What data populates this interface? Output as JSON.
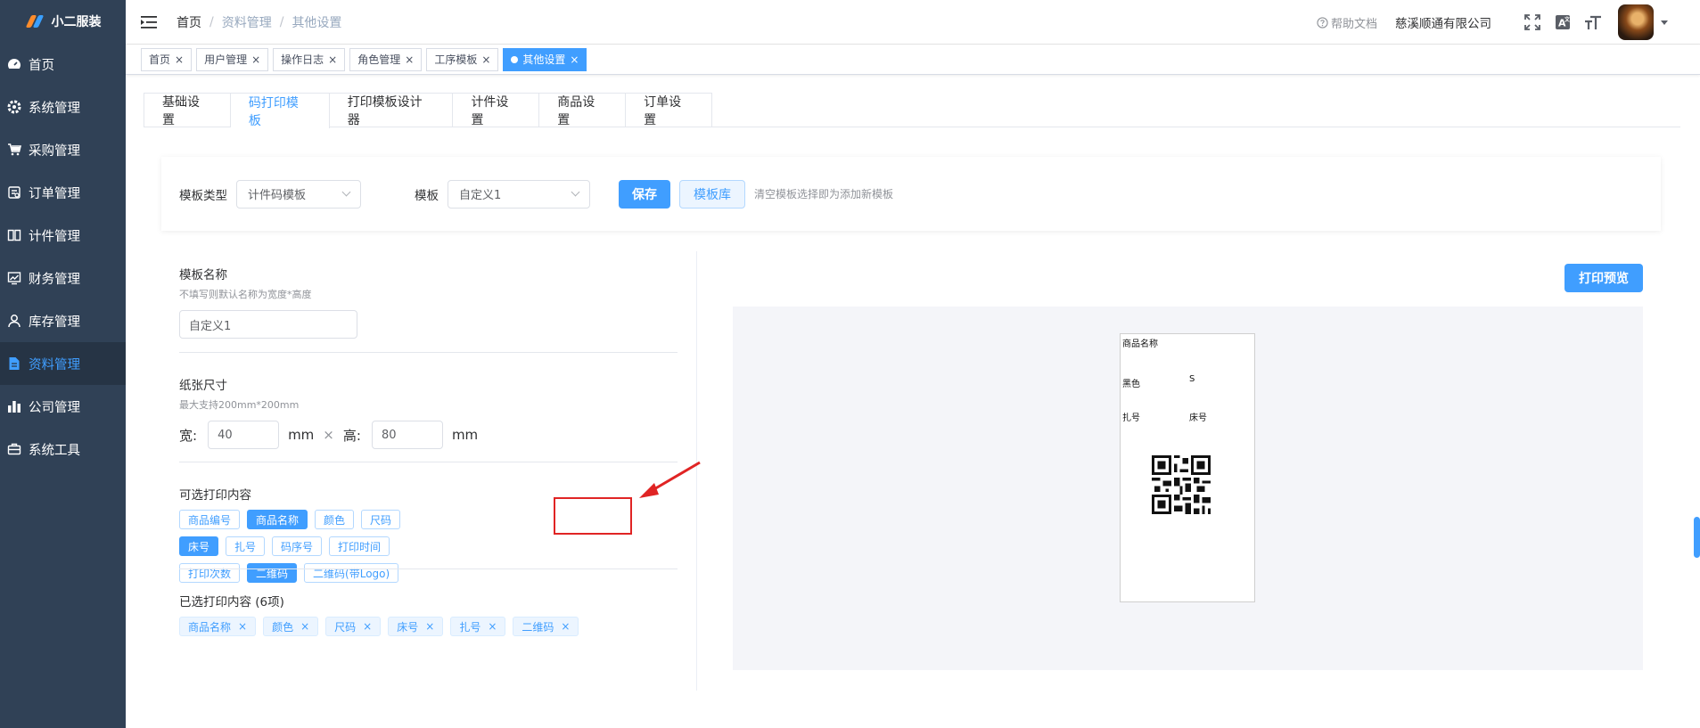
{
  "app": {
    "logo_text": "小二服装"
  },
  "sidebar": {
    "items": [
      {
        "label": "首页",
        "icon": "dashboard-icon",
        "active": false
      },
      {
        "label": "系统管理",
        "icon": "gear-icon",
        "active": false
      },
      {
        "label": "采购管理",
        "icon": "cart-icon",
        "active": false
      },
      {
        "label": "订单管理",
        "icon": "order-icon",
        "active": false
      },
      {
        "label": "计件管理",
        "icon": "book-icon",
        "active": false
      },
      {
        "label": "财务管理",
        "icon": "chart-icon",
        "active": false
      },
      {
        "label": "库存管理",
        "icon": "user-icon",
        "active": false
      },
      {
        "label": "资料管理",
        "icon": "document-icon",
        "active": true
      },
      {
        "label": "公司管理",
        "icon": "bar-chart-icon",
        "active": false
      },
      {
        "label": "系统工具",
        "icon": "toolbox-icon",
        "active": false
      }
    ]
  },
  "header": {
    "breadcrumb": [
      "首页",
      "资料管理",
      "其他设置"
    ],
    "help_label": "帮助文档",
    "company": "慈溪顺通有限公司"
  },
  "tags": [
    {
      "label": "首页",
      "active": false
    },
    {
      "label": "用户管理",
      "active": false
    },
    {
      "label": "操作日志",
      "active": false
    },
    {
      "label": "角色管理",
      "active": false
    },
    {
      "label": "工序模板",
      "active": false
    },
    {
      "label": "其他设置",
      "active": true
    }
  ],
  "tabs": [
    {
      "label": "基础设置",
      "active": false
    },
    {
      "label": "码打印模板",
      "active": true
    },
    {
      "label": "打印模板设计器",
      "active": false
    },
    {
      "label": "计件设置",
      "active": false
    },
    {
      "label": "商品设置",
      "active": false
    },
    {
      "label": "订单设置",
      "active": false
    }
  ],
  "filter": {
    "template_type_label": "模板类型",
    "template_type_value": "计件码模板",
    "template_label": "模板",
    "template_value": "自定义1",
    "save_label": "保存",
    "library_label": "模板库",
    "hint": "清空模板选择即为添加新模板"
  },
  "form": {
    "name_title": "模板名称",
    "name_hint": "不填写则默认名称为宽度*高度",
    "name_value": "自定义1",
    "paper_title": "纸张尺寸",
    "paper_hint": "最大支持200mm*200mm",
    "width_label": "宽:",
    "width_value": "40",
    "unit": "mm",
    "times": "×",
    "height_label": "高:",
    "height_value": "80",
    "optional_title": "可选打印内容",
    "optional_items": [
      {
        "label": "商品编号",
        "on": false
      },
      {
        "label": "商品名称",
        "on": true
      },
      {
        "label": "颜色",
        "on": false
      },
      {
        "label": "尺码",
        "on": false
      },
      {
        "label": "床号",
        "on": true
      },
      {
        "label": "扎号",
        "on": false
      },
      {
        "label": "码序号",
        "on": false
      },
      {
        "label": "打印时间",
        "on": false
      },
      {
        "label": "打印次数",
        "on": false
      },
      {
        "label": "二维码",
        "on": true
      },
      {
        "label": "二维码(带Logo)",
        "on": false
      }
    ],
    "selected_title": "已选打印内容 (6项)",
    "selected_items": [
      "商品名称",
      "颜色",
      "尺码",
      "床号",
      "扎号",
      "二维码"
    ]
  },
  "preview": {
    "button_label": "打印预览",
    "label_texts": {
      "name": "商品名称",
      "color": "黑色",
      "size": "S",
      "bundle": "扎号",
      "bed": "床号"
    }
  },
  "colors": {
    "primary": "#409eff",
    "sidebar_bg": "#304156",
    "annotation": "#e02424"
  }
}
